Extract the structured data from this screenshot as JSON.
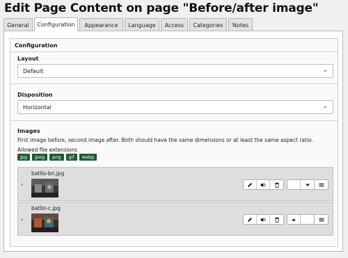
{
  "page": {
    "title": "Edit Page Content on page \"Before/after image\""
  },
  "tabs": [
    {
      "label": "General",
      "active": false
    },
    {
      "label": "Configuration",
      "active": true
    },
    {
      "label": "Appearance",
      "active": false
    },
    {
      "label": "Language",
      "active": false
    },
    {
      "label": "Access",
      "active": false
    },
    {
      "label": "Categories",
      "active": false
    },
    {
      "label": "Notes",
      "active": false
    }
  ],
  "configuration": {
    "section_title": "Configuration",
    "layout": {
      "label": "Layout",
      "value": "Default"
    },
    "disposition": {
      "label": "Disposition",
      "value": "Horizontal"
    },
    "images": {
      "label": "Images",
      "description": "First image before, second image after. Both should have the same dimensions or at least the same aspect ratio.",
      "allowed_label": "Allowed file extensions",
      "extensions": [
        "jpg",
        "jpeg",
        "png",
        "gif",
        "webp"
      ],
      "items": [
        {
          "filename": "batllo-bn.jpg",
          "thumb": "grayscale"
        },
        {
          "filename": "batllo-c.jpg",
          "thumb": "color"
        }
      ]
    }
  },
  "colors": {
    "badge": "#1e5a36",
    "active_tab": "#ffffff",
    "inactive_tab": "#e2e2e2"
  },
  "icons": [
    "pencil-icon",
    "toggle-icon",
    "trash-icon",
    "arrow-up-icon",
    "arrow-down-icon",
    "drag-handle-icon",
    "chevron-down-icon",
    "expand-icon"
  ]
}
